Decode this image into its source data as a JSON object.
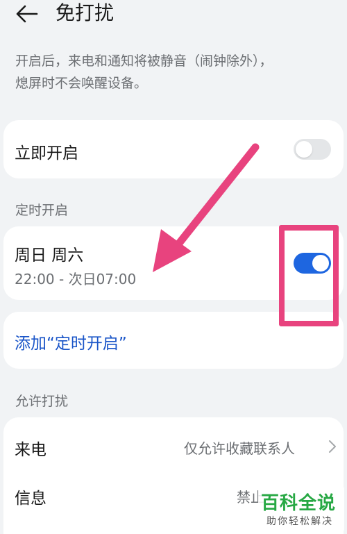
{
  "header": {
    "back_icon": "arrow-left-icon",
    "title": "免打扰"
  },
  "description": {
    "line1": "开启后，来电和通知将被静音（闹钟除外），",
    "line2": "熄屏时不会唤醒设备。"
  },
  "immediate": {
    "label": "立即开启",
    "enabled": false
  },
  "schedule_section": {
    "label": "定时开启",
    "item": {
      "days": "周日 周六",
      "time": "22:00 - 次日07:00",
      "enabled": true
    }
  },
  "add_schedule": {
    "label": "添加“定时开启”"
  },
  "allow_section": {
    "label": "允许打扰",
    "rows": [
      {
        "label": "来电",
        "value": "仅允许收藏联系人"
      },
      {
        "label": "信息",
        "value": "禁止"
      }
    ]
  },
  "watermark": {
    "main": "百科全说",
    "sub": "助你轻松解决"
  },
  "colors": {
    "accent": "#1e66e0",
    "link": "#1a55c8",
    "annotation": "#e8437e",
    "watermark": "#27a844"
  }
}
